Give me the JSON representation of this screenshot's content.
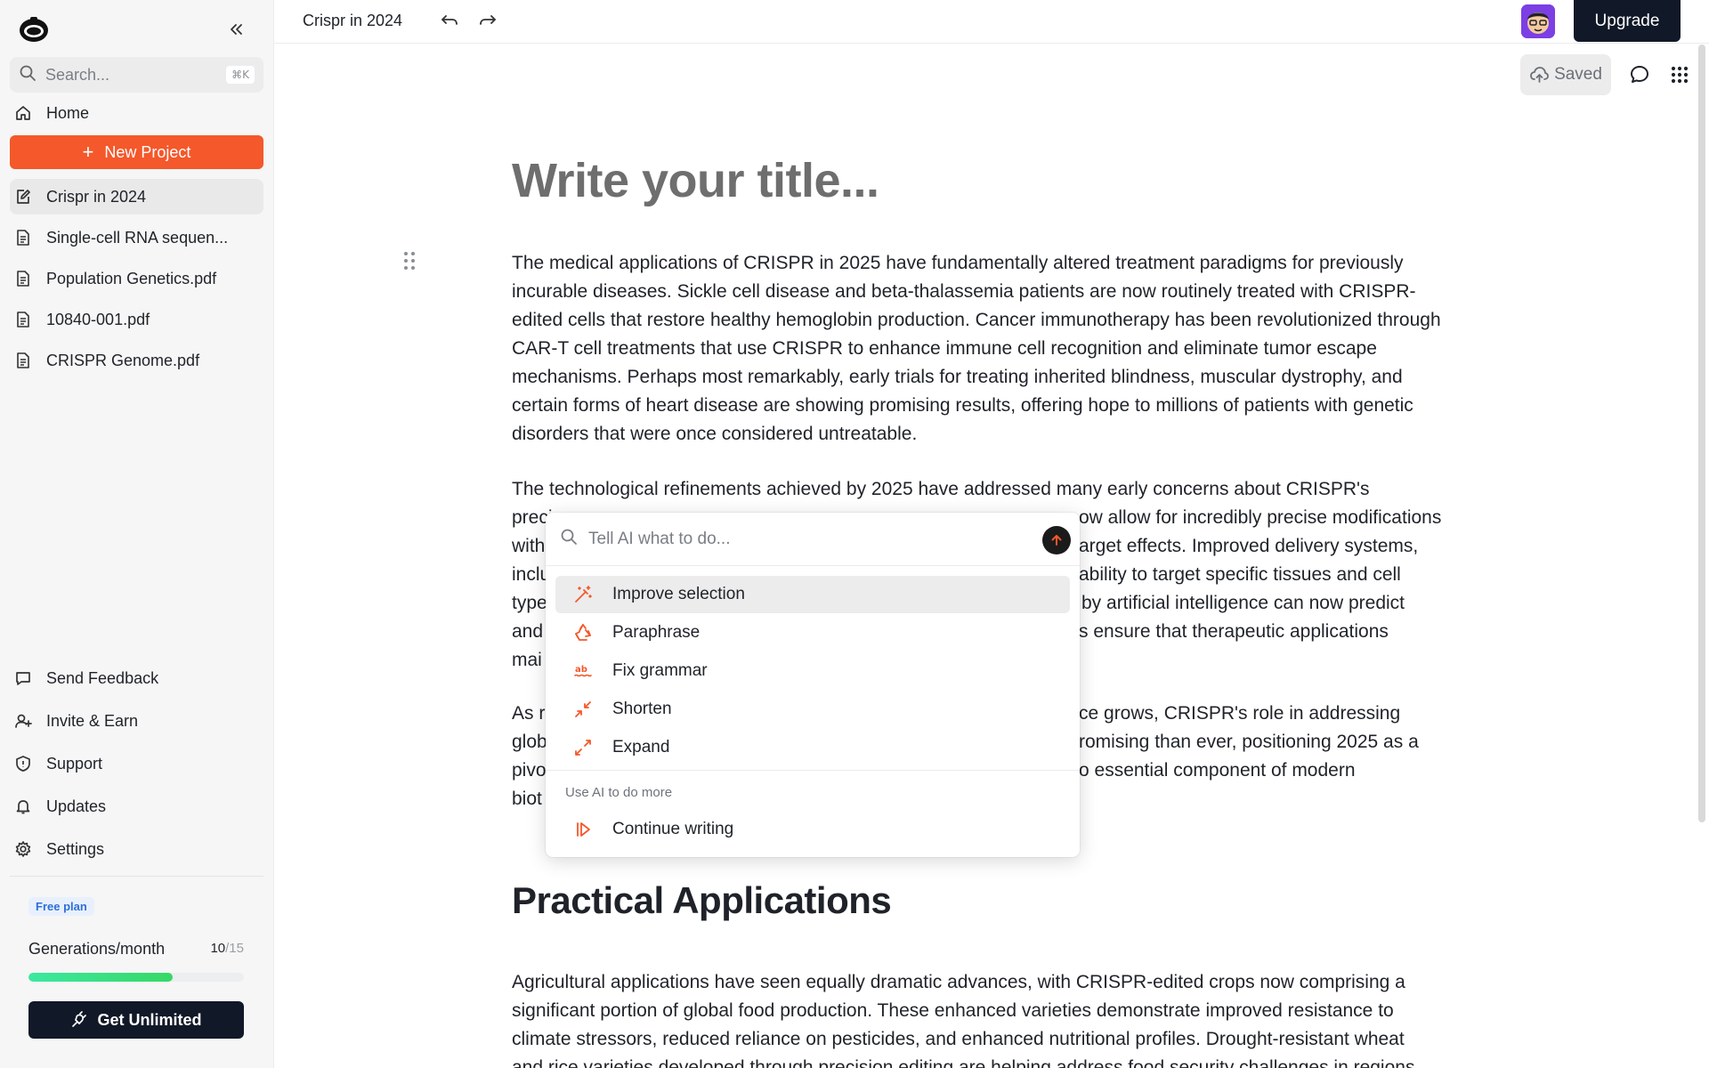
{
  "sidebar": {
    "search_placeholder": "Search...",
    "search_shortcut": "⌘K",
    "home": "Home",
    "new_project": "New Project",
    "files": [
      {
        "label": "Crispr in 2024",
        "active": true
      },
      {
        "label": "Single-cell RNA sequen..."
      },
      {
        "label": "Population Genetics.pdf"
      },
      {
        "label": "10840-001.pdf"
      },
      {
        "label": "CRISPR Genome.pdf"
      }
    ],
    "bottom": {
      "send_feedback": "Send Feedback",
      "invite_earn": "Invite & Earn",
      "support": "Support",
      "updates": "Updates",
      "settings": "Settings"
    },
    "plan": {
      "badge": "Free plan",
      "generations_label": "Generations/month",
      "used": "10",
      "total": "/15",
      "progress": 0.67,
      "cta": "Get Unlimited"
    }
  },
  "topbar": {
    "doc_title": "Crispr in 2024",
    "upgrade": "Upgrade",
    "saved": "Saved"
  },
  "document": {
    "title_placeholder": "Write your title...",
    "para1": "The medical applications of CRISPR in 2025 have fundamentally altered treatment paradigms for previously incurable diseases. Sickle cell disease and beta-thalassemia patients are now routinely treated with CRISPR-edited cells that restore healthy hemoglobin production. Cancer immunotherapy has been revolutionized through CAR-T cell treatments that use CRISPR to enhance immune cell recognition and eliminate tumor escape mechanisms. Perhaps most remarkably, early trials for treating inherited blindness, muscular dystrophy, and certain forms of heart disease are showing promising results, offering hope to millions of patients with genetic disorders that were once considered untreatable.",
    "para2_lines": [
      "The technological refinements achieved by 2025 have addressed many early concerns about CRISPR's",
      "preci",
      "ow allow for incredibly precise modifications",
      "with",
      "arget effects. Improved delivery systems,",
      "inclu",
      "ability to target specific tissues and cell",
      "type",
      "by artificial intelligence can now predict",
      "and",
      "s ensure that therapeutic applications",
      "mai"
    ],
    "para3_lines": [
      "As r",
      "ce grows, CRISPR's role in addressing",
      "glob",
      "romising than ever, positioning 2025 as a",
      "pivo",
      "o essential component of modern",
      "biot"
    ],
    "heading": "Practical Applications",
    "para4_lines": [
      "Agricultural applications have seen equally dramatic advances, with CRISPR-edited crops now comprising a",
      "significant portion of global food production. These enhanced varieties demonstrate improved resistance to",
      "climate stressors, reduced reliance on pesticides, and enhanced nutritional profiles. Drought-resistant wheat",
      "and rice varieties developed through precision editing are helping address food security challenges in regions"
    ]
  },
  "ai_menu": {
    "placeholder": "Tell AI what to do...",
    "items": [
      {
        "label": "Improve selection",
        "icon": "magic-wand-icon"
      },
      {
        "label": "Paraphrase",
        "icon": "recycle-icon"
      },
      {
        "label": "Fix grammar",
        "icon": "spellcheck-icon"
      },
      {
        "label": "Shorten",
        "icon": "shrink-icon"
      },
      {
        "label": "Expand",
        "icon": "expand-icon"
      }
    ],
    "more_header": "Use AI to do more",
    "continue_writing": "Continue writing"
  },
  "colors": {
    "accent": "#f4582b",
    "dark": "#111827",
    "progress": "#37d866"
  }
}
